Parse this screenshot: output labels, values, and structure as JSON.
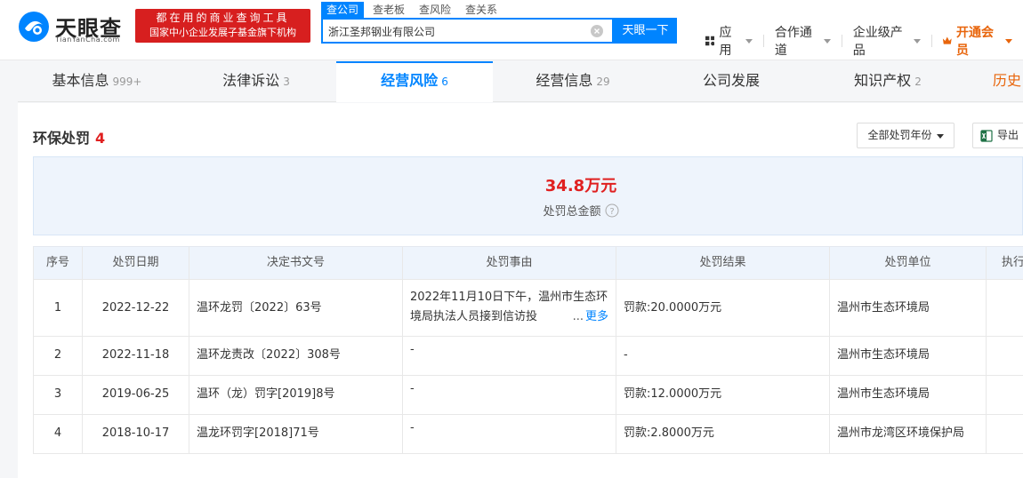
{
  "header": {
    "logo_name": "天眼查",
    "logo_domain": "TianYanCha.com",
    "slogan_line1": "都在用的商业查询工具",
    "slogan_line2": "国家中小企业发展子基金旗下机构",
    "search_tabs": [
      "查公司",
      "查老板",
      "查风险",
      "查关系"
    ],
    "search_value": "浙江圣邦钢业有限公司",
    "search_button": "天眼一下",
    "nav": [
      "应用",
      "合作通道",
      "企业级产品",
      "开通会员"
    ]
  },
  "tabs": [
    {
      "label": "基本信息",
      "count": "999+"
    },
    {
      "label": "法律诉讼",
      "count": "3"
    },
    {
      "label": "经营风险",
      "count": "6"
    },
    {
      "label": "经营信息",
      "count": "29"
    },
    {
      "label": "公司发展",
      "count": ""
    },
    {
      "label": "知识产权",
      "count": "2"
    },
    {
      "label": "历史",
      "count": ""
    }
  ],
  "section": {
    "title": "环保处罚",
    "count": "4",
    "year_filter": "全部处罚年份",
    "export": "导出"
  },
  "summary": {
    "amount": "34.8万元",
    "label": "处罚总金额"
  },
  "table": {
    "headers": [
      "序号",
      "处罚日期",
      "决定书文号",
      "处罚事由",
      "处罚结果",
      "处罚单位",
      "执行"
    ],
    "rows": [
      {
        "no": "1",
        "date": "2022-12-22",
        "doc": "温环龙罚〔2022〕63号",
        "reason": "2022年11月10日下午，温州市生态环境局执法人员接到信访投",
        "more": "更多",
        "result": "罚款:20.0000万元",
        "unit": "温州市生态环境局"
      },
      {
        "no": "2",
        "date": "2022-11-18",
        "doc": "温环龙责改〔2022〕308号",
        "reason": "-",
        "result": "-",
        "unit": "温州市生态环境局"
      },
      {
        "no": "3",
        "date": "2019-06-25",
        "doc": "温环（龙）罚字[2019]8号",
        "reason": "-",
        "result": "罚款:12.0000万元",
        "unit": "温州市生态环境局"
      },
      {
        "no": "4",
        "date": "2018-10-17",
        "doc": "温龙环罚字[2018]71号",
        "reason": "-",
        "result": "罚款:2.8000万元",
        "unit": "温州市龙湾区环境保护局"
      }
    ]
  },
  "colors": {
    "brand_blue": "#0084ff",
    "alert_red": "#e02020",
    "slogan_red": "#d71f1f",
    "vip_orange": "#e8650c"
  }
}
